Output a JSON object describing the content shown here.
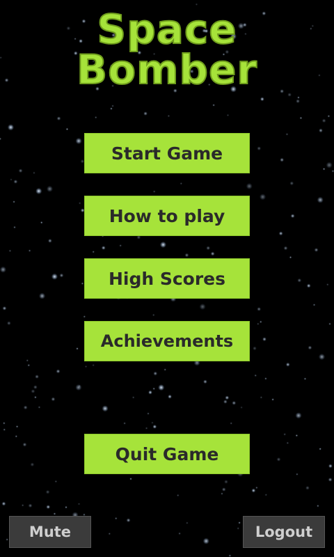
{
  "title": {
    "line1": "Space",
    "line2": "Bomber"
  },
  "menu": {
    "start": "Start Game",
    "how_to_play": "How to play",
    "high_scores": "High Scores",
    "achievements": "Achievements",
    "quit": "Quit Game"
  },
  "bottom": {
    "mute": "Mute",
    "logout": "Logout"
  },
  "colors": {
    "accent": "#a6e33a",
    "background": "#000000",
    "button_dark": "#3b3b3b",
    "button_text": "#2a2a2a"
  }
}
